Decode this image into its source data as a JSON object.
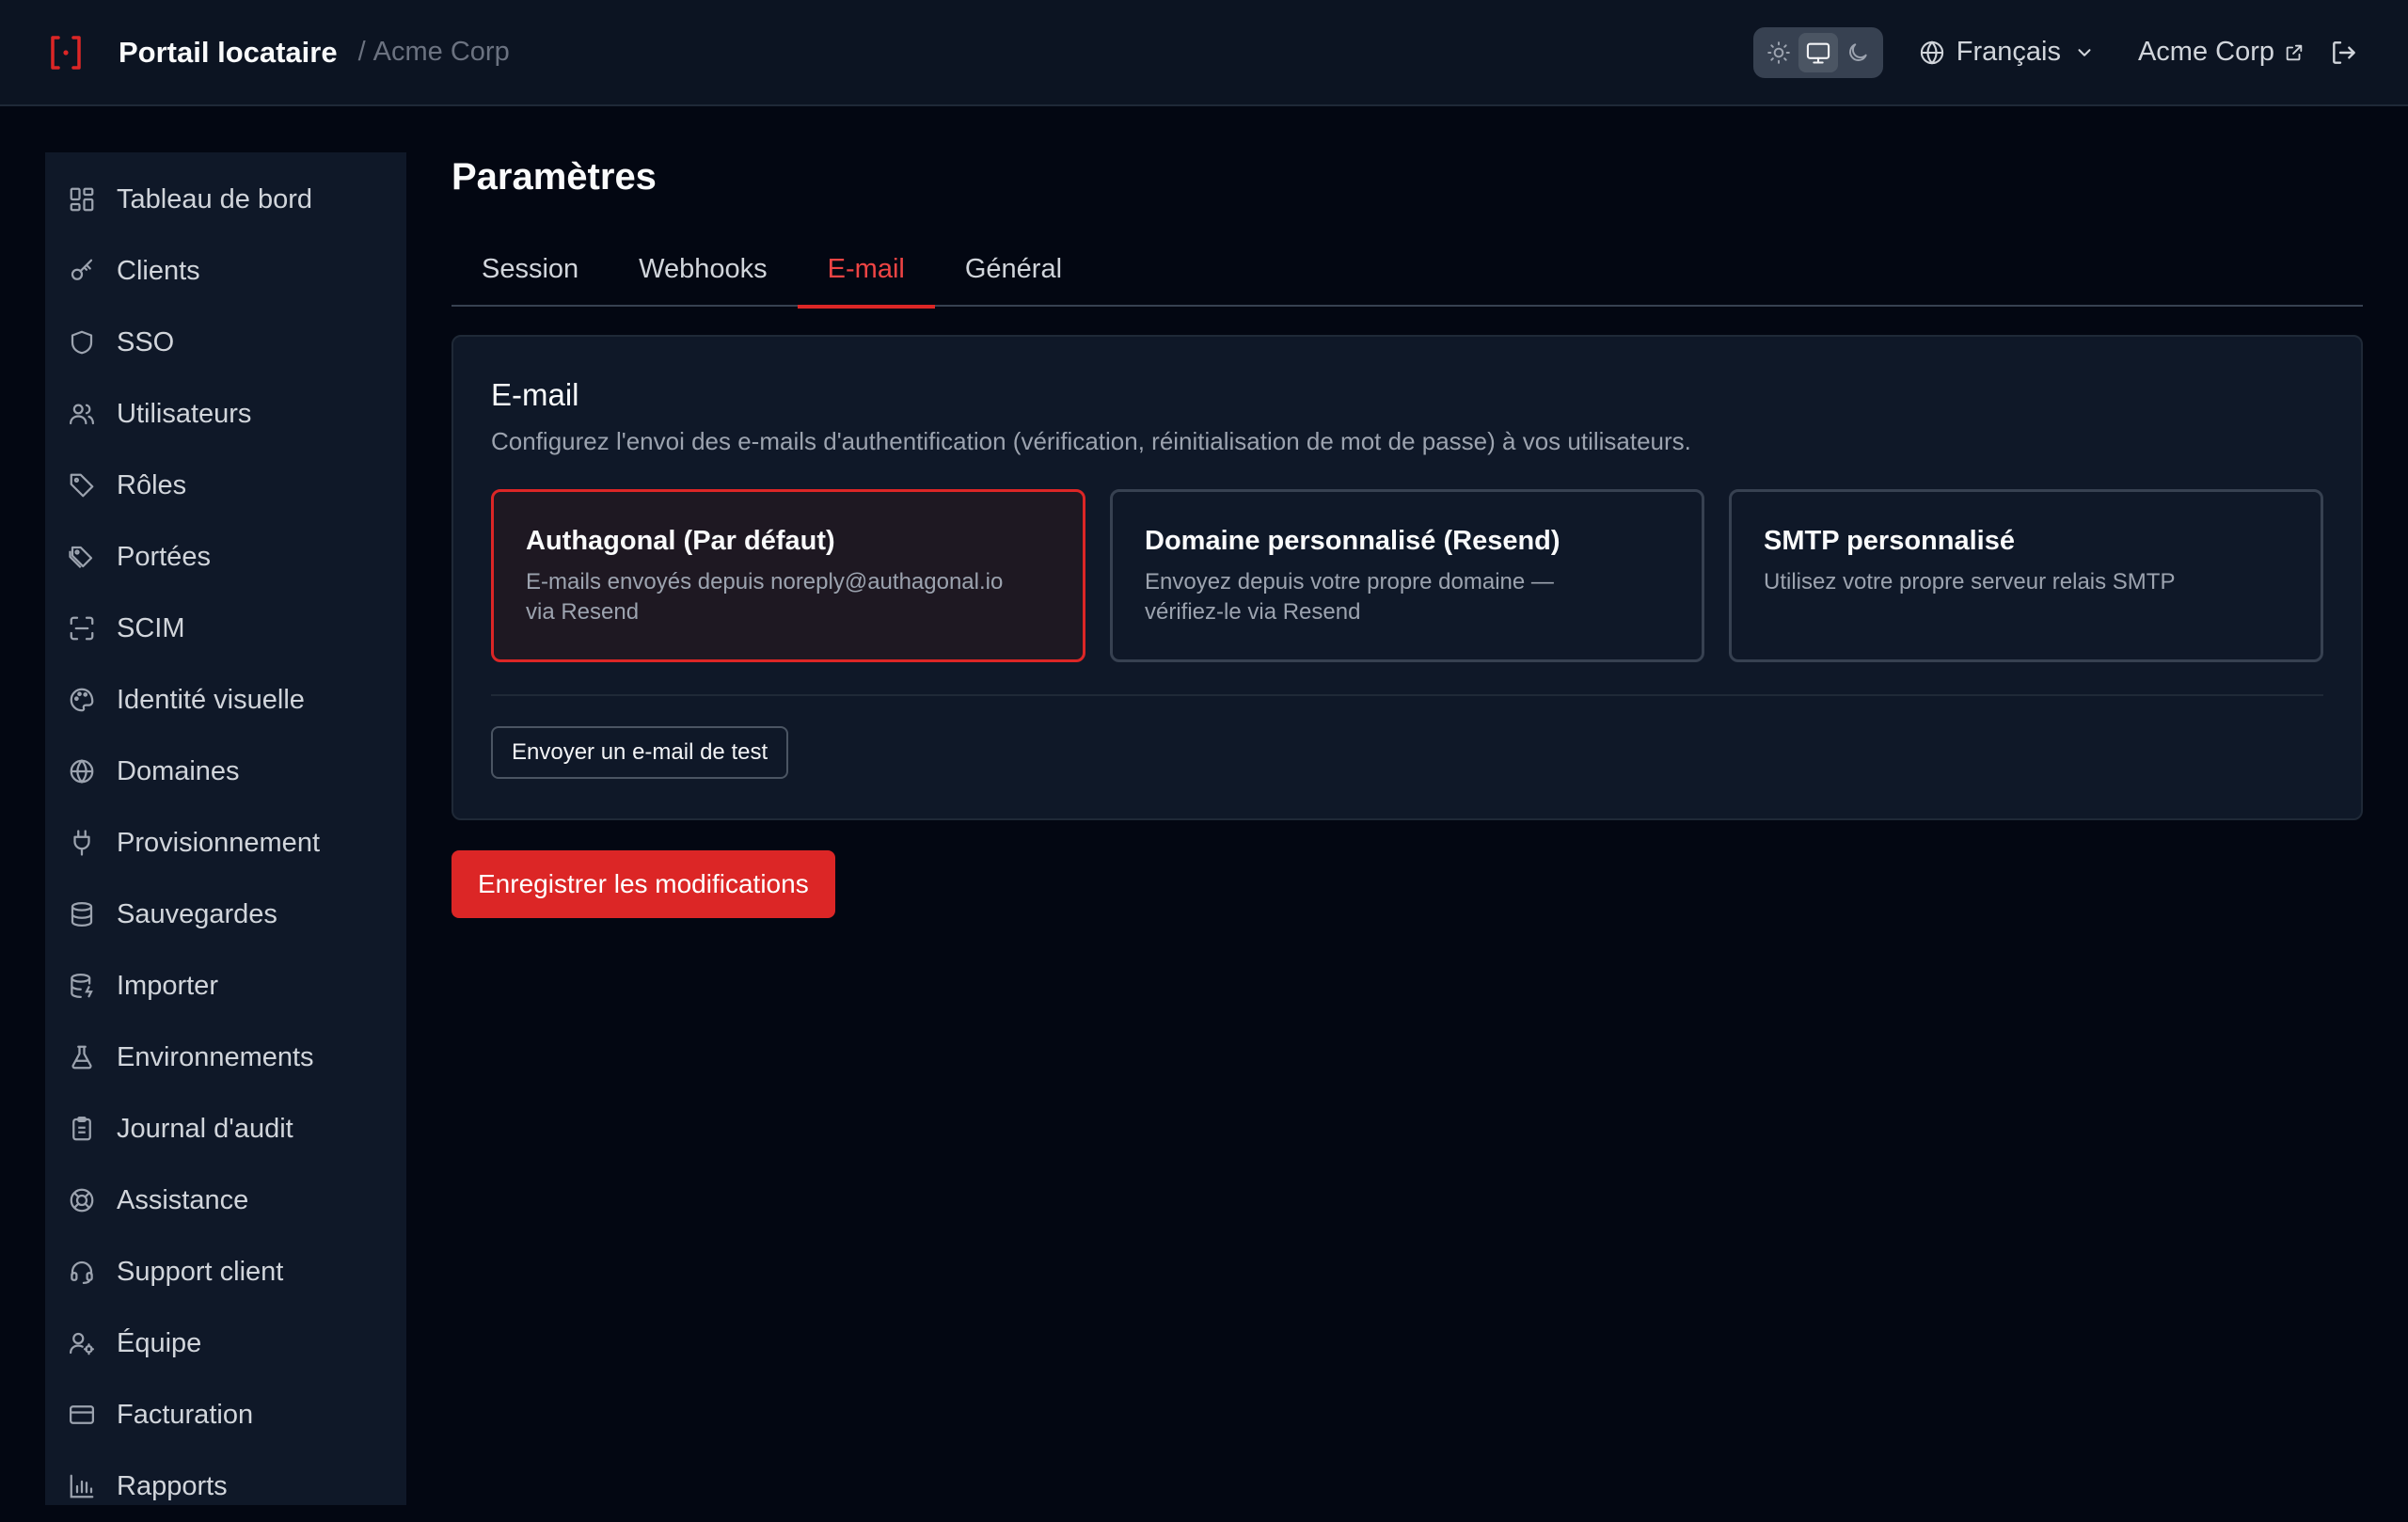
{
  "header": {
    "title": "Portail locataire",
    "breadcrumb_separator": "/",
    "tenant_breadcrumb": "Acme Corp",
    "language": "Français",
    "tenant_link": "Acme Corp",
    "theme_selected": "system",
    "accent_color": "#dc2626"
  },
  "sidebar": {
    "items": [
      {
        "label": "Tableau de bord",
        "icon": "dashboard-icon"
      },
      {
        "label": "Clients",
        "icon": "key-icon"
      },
      {
        "label": "SSO",
        "icon": "shield-icon"
      },
      {
        "label": "Utilisateurs",
        "icon": "users-icon"
      },
      {
        "label": "Rôles",
        "icon": "tag-icon"
      },
      {
        "label": "Portées",
        "icon": "tags-icon"
      },
      {
        "label": "SCIM",
        "icon": "scan-icon"
      },
      {
        "label": "Identité visuelle",
        "icon": "palette-icon"
      },
      {
        "label": "Domaines",
        "icon": "globe-icon"
      },
      {
        "label": "Provisionnement",
        "icon": "plug-icon"
      },
      {
        "label": "Sauvegardes",
        "icon": "database-icon"
      },
      {
        "label": "Importer",
        "icon": "database-import-icon"
      },
      {
        "label": "Environnements",
        "icon": "flask-icon"
      },
      {
        "label": "Journal d'audit",
        "icon": "clipboard-icon"
      },
      {
        "label": "Assistance",
        "icon": "lifebuoy-icon"
      },
      {
        "label": "Support client",
        "icon": "headset-icon"
      },
      {
        "label": "Équipe",
        "icon": "user-cog-icon"
      },
      {
        "label": "Facturation",
        "icon": "credit-card-icon"
      },
      {
        "label": "Rapports",
        "icon": "bar-chart-icon"
      }
    ]
  },
  "main": {
    "title": "Paramètres",
    "tabs": [
      {
        "label": "Session",
        "active": false
      },
      {
        "label": "Webhooks",
        "active": false
      },
      {
        "label": "E-mail",
        "active": true
      },
      {
        "label": "Général",
        "active": false
      }
    ],
    "card": {
      "title": "E-mail",
      "description": "Configurez l'envoi des e-mails d'authentification (vérification, réinitialisation de mot de passe) à vos utilisateurs.",
      "options": [
        {
          "title": "Authagonal (Par défaut)",
          "desc_line1": "E-mails envoyés depuis noreply@authagonal.io",
          "desc_line2": "via Resend",
          "selected": true
        },
        {
          "title": "Domaine personnalisé (Resend)",
          "desc_line1": "Envoyez depuis votre propre domaine —",
          "desc_line2": "vérifiez-le via Resend",
          "selected": false
        },
        {
          "title": "SMTP personnalisé",
          "desc_line1": "Utilisez votre propre serveur relais SMTP",
          "desc_line2": "",
          "selected": false
        }
      ],
      "test_button": "Envoyer un e-mail de test"
    },
    "save_button": "Enregistrer les modifications"
  }
}
